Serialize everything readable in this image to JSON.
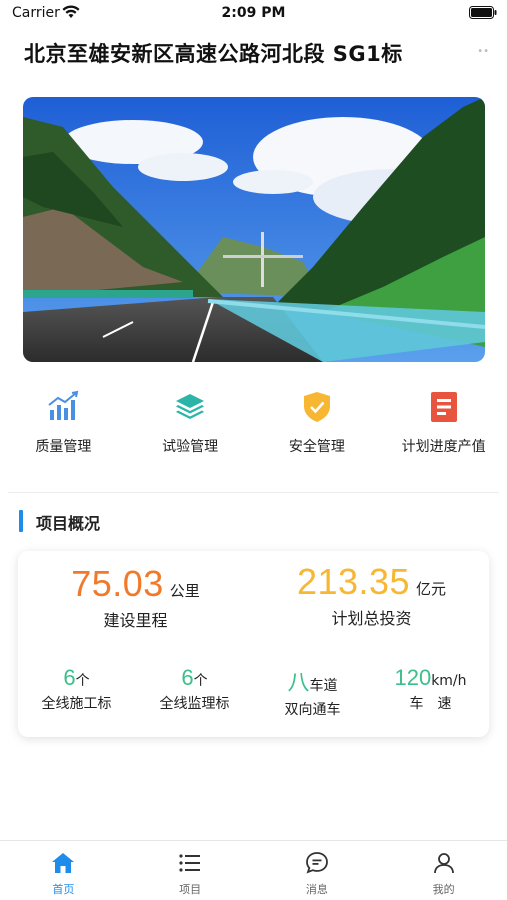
{
  "status_bar": {
    "carrier": "Carrier",
    "time": "2:09 PM"
  },
  "header": {
    "title": "北京至雄安新区高速公路河北段  SG1标"
  },
  "quick_menu": [
    {
      "label": "质量管理",
      "icon": "chart-bar-icon",
      "color": "#4a90e2"
    },
    {
      "label": "试验管理",
      "icon": "layers-icon",
      "color": "#2bb5a8"
    },
    {
      "label": "安全管理",
      "icon": "shield-check-icon",
      "color": "#f7b733"
    },
    {
      "label": "计划进度产值",
      "icon": "document-icon",
      "color": "#e8553e"
    }
  ],
  "overview": {
    "section_title": "项目概况",
    "mileage": {
      "value": "75.03",
      "unit": "公里",
      "label": "建设里程",
      "color": "#f07a2a"
    },
    "investment": {
      "value": "213.35",
      "unit": "亿元",
      "label": "计划总投资",
      "color": "#f7b733"
    },
    "stats": [
      {
        "value": "6",
        "unit": "个",
        "label": "全线施工标"
      },
      {
        "value": "6",
        "unit": "个",
        "label": "全线监理标"
      },
      {
        "value": "八",
        "unit": "车道",
        "label": "双向通车"
      },
      {
        "value": "120",
        "unit": "km/h",
        "label": "车　速"
      }
    ]
  },
  "tab_bar": [
    {
      "label": "首页",
      "icon": "home-icon",
      "active": true
    },
    {
      "label": "项目",
      "icon": "list-icon",
      "active": false
    },
    {
      "label": "消息",
      "icon": "message-icon",
      "active": false
    },
    {
      "label": "我的",
      "icon": "user-icon",
      "active": false
    }
  ],
  "colors": {
    "accent": "#1f8cec",
    "green": "#3cbf8a"
  }
}
